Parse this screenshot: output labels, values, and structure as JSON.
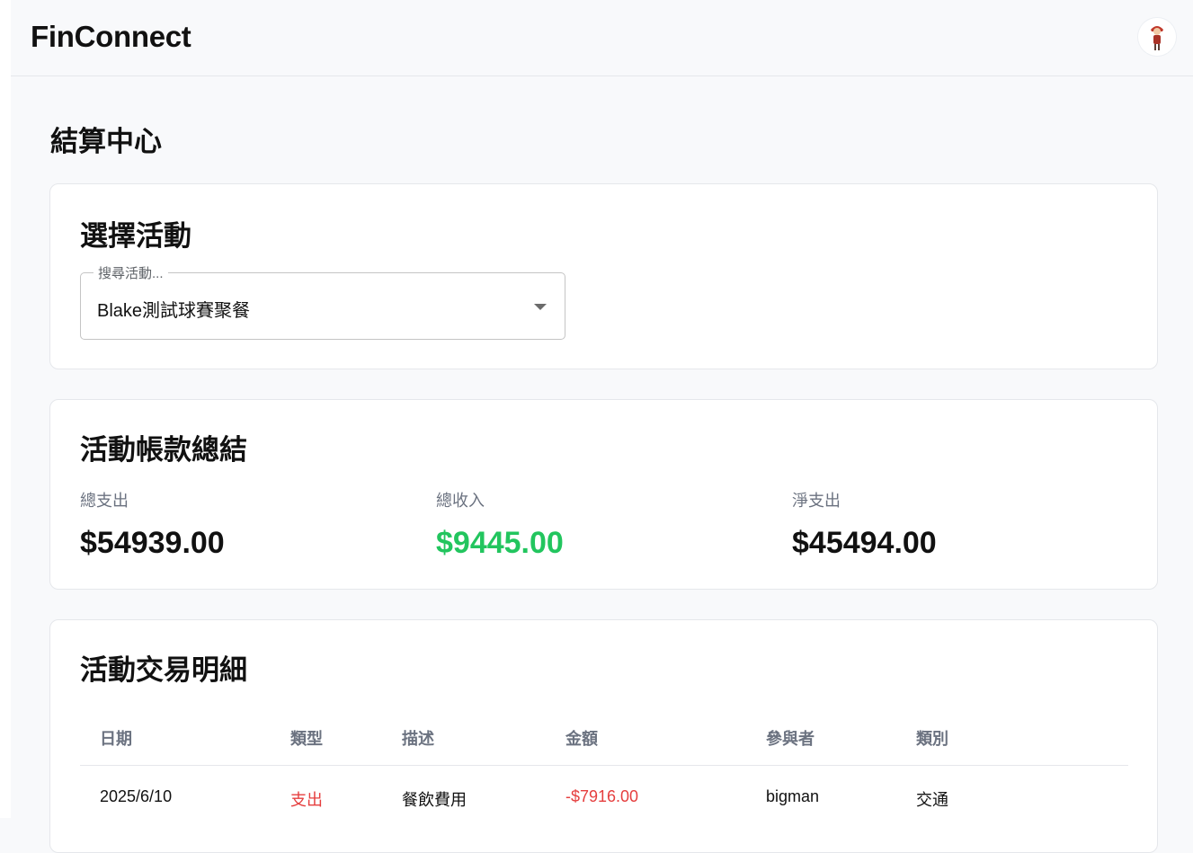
{
  "app": {
    "brand": "FinConnect",
    "avatar_icon": "user-avatar-icon"
  },
  "page": {
    "title": "結算中心"
  },
  "select_activity": {
    "title": "選擇活動",
    "field_label": "搜尋活動...",
    "value": "Blake測試球賽聚餐"
  },
  "summary": {
    "title": "活動帳款總結",
    "stats": [
      {
        "label": "總支出",
        "value": "$54939.00"
      },
      {
        "label": "總收入",
        "value": "$9445.00"
      },
      {
        "label": "淨支出",
        "value": "$45494.00"
      }
    ]
  },
  "transactions": {
    "title": "活動交易明細",
    "columns": [
      "日期",
      "類型",
      "描述",
      "金額",
      "參與者",
      "類別"
    ],
    "rows": [
      {
        "date": "2025/6/10",
        "type": "支出",
        "description": "餐飲費用",
        "amount": "-$7916.00",
        "participant": "bigman",
        "category": "交通"
      }
    ]
  },
  "colors": {
    "income": "#22c55e",
    "expense": "#e53e3e",
    "muted": "#6b7280"
  }
}
